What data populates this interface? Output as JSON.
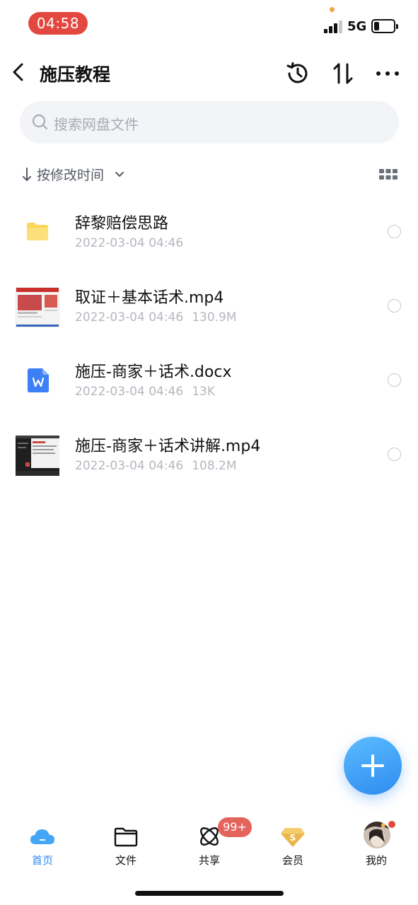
{
  "status_bar": {
    "time": "04:58",
    "network": "5G"
  },
  "nav": {
    "title": "施压教程"
  },
  "search": {
    "placeholder": "搜索网盘文件"
  },
  "sort": {
    "label": "按修改时间"
  },
  "files": [
    {
      "name": "辞黎赔偿思路",
      "date": "2022-03-04 04:46",
      "size": "",
      "type": "folder"
    },
    {
      "name": "取证＋基本话术.mp4",
      "date": "2022-03-04 04:46",
      "size": "130.9M",
      "type": "video"
    },
    {
      "name": "施压-商家＋话术.docx",
      "date": "2022-03-04 04:46",
      "size": "13K",
      "type": "word"
    },
    {
      "name": "施压-商家＋话术讲解.mp4",
      "date": "2022-03-04 04:46",
      "size": "108.2M",
      "type": "video"
    }
  ],
  "tabs": [
    {
      "label": "首页",
      "icon": "cloud-icon",
      "active": true
    },
    {
      "label": "文件",
      "icon": "folder-icon",
      "active": false
    },
    {
      "label": "共享",
      "icon": "share-orbit-icon",
      "active": false,
      "badge": "99+"
    },
    {
      "label": "会员",
      "icon": "vip-diamond-icon",
      "active": false
    },
    {
      "label": "我的",
      "icon": "avatar",
      "active": false
    }
  ],
  "colors": {
    "accent": "#2f8cf0",
    "time_pill": "#e2483f",
    "badge": "#e4645c",
    "folder": "#f9d75a",
    "word": "#3d7ff5"
  }
}
